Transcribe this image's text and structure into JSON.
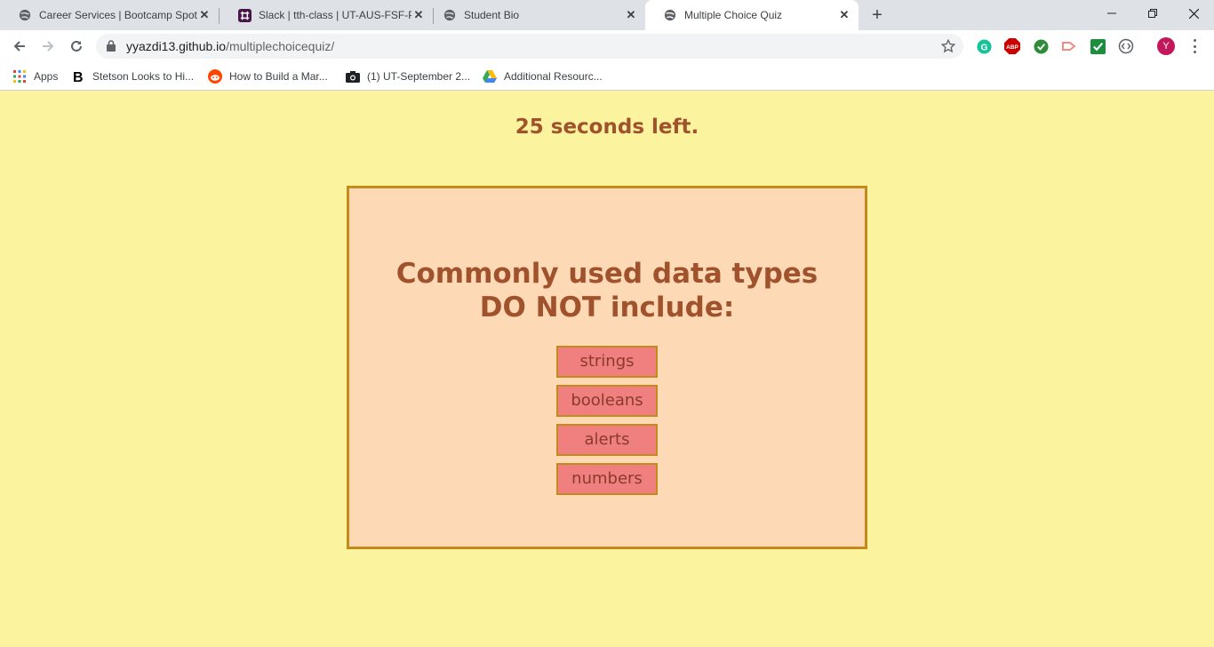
{
  "browser": {
    "tabs": [
      {
        "title": "Career Services | Bootcamp Spot",
        "icon": "globe-icon"
      },
      {
        "title": "Slack | tth-class | UT-AUS-FSF-PT",
        "icon": "slack-icon"
      },
      {
        "title": "Student Bio",
        "icon": "globe-icon"
      },
      {
        "title": "Multiple Choice Quiz",
        "icon": "globe-icon",
        "active": true
      }
    ],
    "url_host": "yyazdi13.github.io",
    "url_path": "/multiplechoicequiz/",
    "profile_initial": "Y",
    "bookmarks": [
      {
        "label": "Apps",
        "icon": "apps-grid-icon"
      },
      {
        "label": "Stetson Looks to Hi...",
        "icon": "b-logo-icon"
      },
      {
        "label": "How to Build a Mar...",
        "icon": "reddit-icon"
      },
      {
        "label": "(1) UT-September 2...",
        "icon": "camera-icon"
      },
      {
        "label": "Additional Resourc...",
        "icon": "drive-icon"
      }
    ],
    "extensions": [
      "grammarly-icon",
      "adblock-icon",
      "checkmark-extension-icon",
      "cast-extension-icon",
      "task-check-icon",
      "code-extension-icon"
    ]
  },
  "quiz": {
    "timer_text": "25 seconds left.",
    "question_line1": "Commonly used data types",
    "question_line2": "DO NOT include:",
    "choices": [
      "strings",
      "booleans",
      "alerts",
      "numbers"
    ]
  },
  "colors": {
    "page_background": "#fbf39e",
    "quiz_box_background": "#fdd9b5",
    "quiz_box_border": "#c48b1a",
    "heading_text": "#a0522d",
    "choice_background": "#f08080"
  }
}
